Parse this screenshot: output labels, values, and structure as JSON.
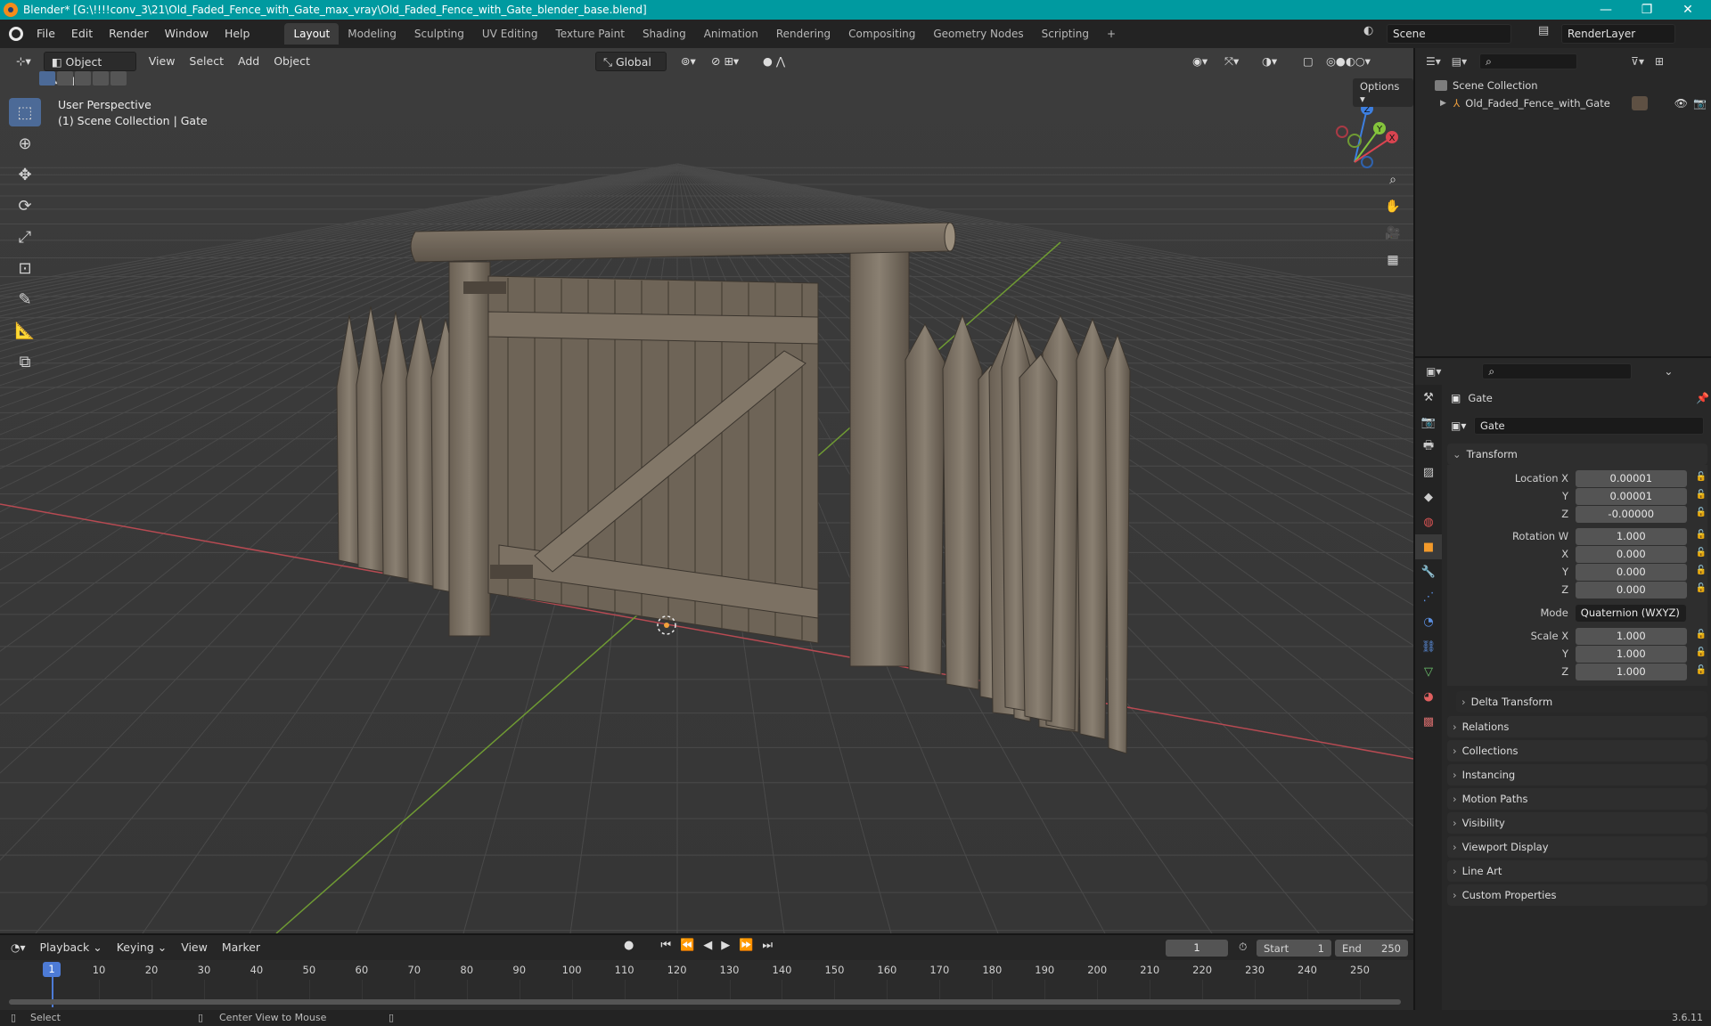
{
  "window": {
    "title": "Blender* [G:\\!!!!conv_3\\21\\Old_Faded_Fence_with_Gate_max_vray\\Old_Faded_Fence_with_Gate_blender_base.blend]",
    "minimize": "—",
    "maximize": "❐",
    "close": "✕"
  },
  "menu": {
    "items": [
      "File",
      "Edit",
      "Render",
      "Window",
      "Help"
    ],
    "workspaces": [
      "Layout",
      "Modeling",
      "Sculpting",
      "UV Editing",
      "Texture Paint",
      "Shading",
      "Animation",
      "Rendering",
      "Compositing",
      "Geometry Nodes",
      "Scripting"
    ],
    "add_tab": "+",
    "scene": "Scene",
    "render_layer": "RenderLayer"
  },
  "viewport": {
    "mode": "Object Mode",
    "menus": [
      "View",
      "Select",
      "Add",
      "Object"
    ],
    "orientation": "Global",
    "options": "Options",
    "info_line1": "User Perspective",
    "info_line2": "(1) Scene Collection | Gate",
    "gizmo": {
      "z": "Z",
      "y": "Y",
      "x": "X"
    }
  },
  "outliner": {
    "root": "Scene Collection",
    "object": "Old_Faded_Fence_with_Gate"
  },
  "properties": {
    "object_name": "Gate",
    "data_name": "Gate",
    "transform_title": "Transform",
    "location": {
      "label": "Location X",
      "x": "0.00001",
      "y": "0.00001",
      "z": "-0.00000"
    },
    "rotation": {
      "label": "Rotation W",
      "w": "1.000",
      "x": "0.000",
      "y": "0.000",
      "z": "0.000"
    },
    "mode": {
      "label": "Mode",
      "value": "Quaternion (WXYZ)"
    },
    "scale": {
      "label": "Scale X",
      "x": "1.000",
      "y": "1.000",
      "z": "1.000"
    },
    "axis": {
      "y": "Y",
      "z": "Z",
      "x": "X"
    },
    "delta": "Delta Transform",
    "panels": [
      "Relations",
      "Collections",
      "Instancing",
      "Motion Paths",
      "Visibility",
      "Viewport Display",
      "Line Art",
      "Custom Properties"
    ]
  },
  "timeline": {
    "menus": [
      "Playback",
      "Keying",
      "View",
      "Marker"
    ],
    "current_frame": "1",
    "start_label": "Start",
    "start": "1",
    "end_label": "End",
    "end": "250",
    "ticks": [
      "1",
      "10",
      "20",
      "30",
      "40",
      "50",
      "60",
      "70",
      "80",
      "90",
      "100",
      "110",
      "120",
      "130",
      "140",
      "150",
      "160",
      "170",
      "180",
      "190",
      "200",
      "210",
      "220",
      "230",
      "240",
      "250"
    ]
  },
  "status": {
    "select": "Select",
    "center": "Center View to Mouse",
    "version": "3.6.11"
  },
  "colors": {
    "titlebar": "#009aa0",
    "active_tool": "#4c6a97",
    "x_axis": "#d94450",
    "y_axis": "#84c43c",
    "z_axis": "#3d7fe0",
    "wood": "#716659"
  }
}
